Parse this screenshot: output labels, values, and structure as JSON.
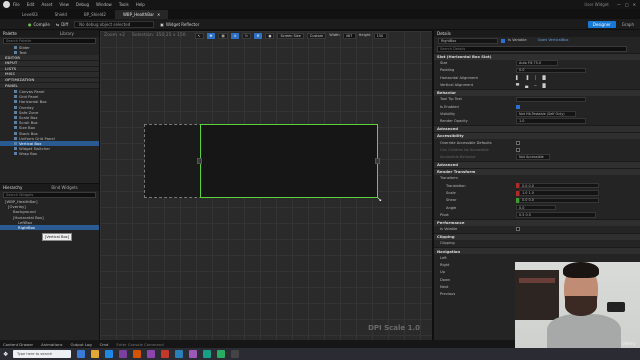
{
  "menu": {
    "items": [
      "File",
      "Edit",
      "Asset",
      "View",
      "Debug",
      "Window",
      "Tools",
      "Help"
    ],
    "user_label": "User Widget"
  },
  "tabs": [
    {
      "label": "Level03",
      "active": false
    },
    {
      "label": "Shield",
      "active": false
    },
    {
      "label": "BP_Shield2",
      "active": false
    },
    {
      "label": "WBP_HealthBar",
      "active": true
    }
  ],
  "toolbar": {
    "compile": "Compile",
    "diff": "Diff",
    "debug_filter": "No debug object selected",
    "widget_reflector": "Widget Reflector",
    "designer": "Designer",
    "graph": "Graph"
  },
  "palette": {
    "title": "Palette",
    "library": "Library",
    "search_placeholder": "Search Palette",
    "items_top": [
      "Slider",
      "Text"
    ],
    "categories": [
      "EDITOR",
      "INPUT",
      "LISTS",
      "MISC",
      "OPTIMIZATION",
      "PANEL"
    ],
    "panel_items": [
      "Canvas Panel",
      "Grid Panel",
      "Horizontal Box",
      "Overlay",
      "Safe Zone",
      "Scale Box",
      "Scroll Box",
      "Size Box",
      "Stack Box",
      "Uniform Grid Panel",
      "Vertical Box",
      "Widget Switcher",
      "Wrap Box"
    ],
    "selected_item": "Vertical Box"
  },
  "hierarchy": {
    "title": "Hierarchy",
    "bind_widgets": "Bind Widgets",
    "search_placeholder": "Search Widgets",
    "rows": [
      {
        "label": "[WBP_HealthBar]",
        "depth": 0
      },
      {
        "label": "[Overlay]",
        "depth": 1
      },
      {
        "label": "Background",
        "depth": 2
      },
      {
        "label": "[Horizontal Box]",
        "depth": 2
      },
      {
        "label": "LeftBox",
        "depth": 3
      },
      {
        "label": "RightBox",
        "depth": 3
      }
    ],
    "selected_row": "RightBox",
    "tooltip": "[Vertical Box]"
  },
  "canvas": {
    "zoom": "Zoom +2",
    "selection": "Selection: 350.25 x 150",
    "mode": "Screen Size",
    "size_mode": "Custom",
    "width_label": "Width",
    "width": "467",
    "height_label": "Height",
    "height": "150",
    "dpi": "DPI Scale 1.0"
  },
  "details": {
    "title": "Details",
    "name": "RightBox",
    "is_variable": "Is Variable",
    "class_button": "Open VerticalBox",
    "search_placeholder": "Search Details",
    "sections": [
      {
        "title": "Slot (Horizontal Box Slot)",
        "rows": [
          {
            "label": "Size",
            "value": "Auto  Fill  75.0"
          },
          {
            "label": "Padding",
            "value": "0.0"
          },
          {
            "label": "Horizontal Alignment",
            "value": ""
          },
          {
            "label": "Vertical Alignment",
            "value": ""
          }
        ]
      },
      {
        "title": "Behavior",
        "rows": [
          {
            "label": "Tool Tip Text",
            "value": ""
          },
          {
            "label": "Is Enabled",
            "value": "check"
          },
          {
            "label": "Visibility",
            "value": "Not Hit-Testable (Self Only)"
          },
          {
            "label": "Render Opacity",
            "value": "1.0"
          }
        ]
      },
      {
        "title": "Advanced",
        "rows": []
      },
      {
        "title": "Accessibility",
        "rows": [
          {
            "label": "Override Accessible Defaults",
            "value": ""
          },
          {
            "label": "Can Children be Accessible",
            "value": ""
          },
          {
            "label": "Accessible Behavior",
            "value": "Not Accessible"
          }
        ]
      },
      {
        "title": "Advanced",
        "rows": []
      },
      {
        "title": "Render Transform",
        "rows": [
          {
            "label": "Transform",
            "value": ""
          },
          {
            "label": "Translation",
            "value": "0.0    0.0"
          },
          {
            "label": "Scale",
            "value": "1.0    1.0"
          },
          {
            "label": "Shear",
            "value": "0.0    0.0"
          },
          {
            "label": "Angle",
            "value": "0.0"
          },
          {
            "label": "Pivot",
            "value": "0.5    0.5"
          }
        ]
      },
      {
        "title": "Performance",
        "rows": [
          {
            "label": "Is Volatile",
            "value": ""
          }
        ]
      },
      {
        "title": "Clipping",
        "rows": [
          {
            "label": "Clipping",
            "value": ""
          }
        ]
      },
      {
        "title": "Navigation",
        "rows": [
          {
            "label": "Left",
            "value": ""
          },
          {
            "label": "Right",
            "value": ""
          },
          {
            "label": "Up",
            "value": ""
          },
          {
            "label": "Down",
            "value": ""
          },
          {
            "label": "Next",
            "value": ""
          },
          {
            "label": "Previous",
            "value": ""
          }
        ]
      }
    ]
  },
  "bottom_bar": {
    "items": [
      "Content Drawer",
      "Animations",
      "Output Log",
      "Cmd"
    ],
    "cmd_placeholder": "Enter Console Command"
  },
  "taskbar": {
    "search_placeholder": "Type here to search"
  },
  "webcam": {
    "watermark": "Udemy"
  },
  "colors": {
    "accent": "#1778d6",
    "selection_outline": "#5dd13b",
    "panel_bg": "#242424"
  }
}
